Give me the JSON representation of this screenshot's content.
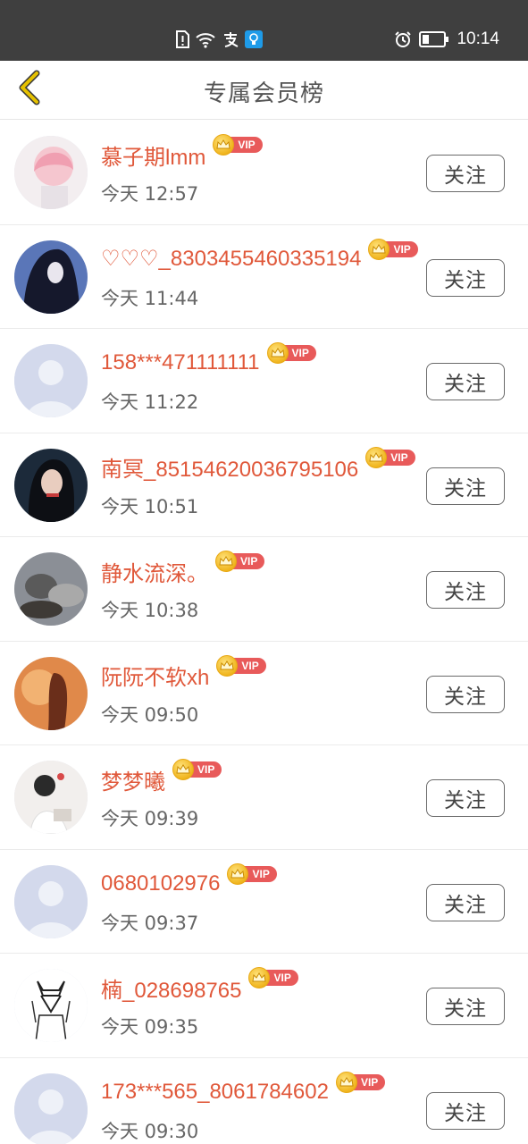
{
  "status_bar": {
    "time": "10:14",
    "icons": [
      "sim-alert-icon",
      "wifi-icon",
      "alipay-icon",
      "bulb-app-icon",
      "alarm-icon",
      "battery-icon"
    ],
    "bg_color": "#3f3f3f"
  },
  "header": {
    "title": "专属会员榜",
    "back_icon": "chevron-left-icon",
    "accent_color": "#e5c100"
  },
  "members": [
    {
      "name": "慕子期lmm",
      "badge": "VIP",
      "time": "今天 12:57",
      "follow_label": "关注",
      "avatar": "pink-hair-anime-avatar"
    },
    {
      "name": "♡♡♡_8303455460335194",
      "badge": "VIP",
      "time": "今天 11:44",
      "follow_label": "关注",
      "avatar": "dark-hair-girl-avatar"
    },
    {
      "name": "158***471111111",
      "badge": "VIP",
      "time": "今天 11:22",
      "follow_label": "关注",
      "avatar": "default-avatar"
    },
    {
      "name": "南冥_85154620036795106",
      "badge": "VIP",
      "time": "今天 10:51",
      "follow_label": "关注",
      "avatar": "singer-photo-avatar"
    },
    {
      "name": "静水流深。",
      "badge": "VIP",
      "time": "今天 10:38",
      "follow_label": "关注",
      "avatar": "cats-photo-avatar"
    },
    {
      "name": "阮阮不软xh",
      "badge": "VIP",
      "time": "今天 09:50",
      "follow_label": "关注",
      "avatar": "sunset-silhouette-avatar"
    },
    {
      "name": "梦梦曦",
      "badge": "VIP",
      "time": "今天 09:39",
      "follow_label": "关注",
      "avatar": "girl-with-book-avatar"
    },
    {
      "name": "0680102976",
      "badge": "VIP",
      "time": "今天 09:37",
      "follow_label": "关注",
      "avatar": "default-avatar"
    },
    {
      "name": "楠_028698765",
      "badge": "VIP",
      "time": "今天 09:35",
      "follow_label": "关注",
      "avatar": "sketch-fox-mask-avatar"
    },
    {
      "name": "173***565_8061784602",
      "badge": "VIP",
      "time": "今天 09:30",
      "follow_label": "关注",
      "avatar": "default-avatar"
    }
  ],
  "colors": {
    "name": "#e0583a",
    "vip_badge": "#e85a5a",
    "crown": "#f0b51e",
    "time_text": "#666666"
  }
}
